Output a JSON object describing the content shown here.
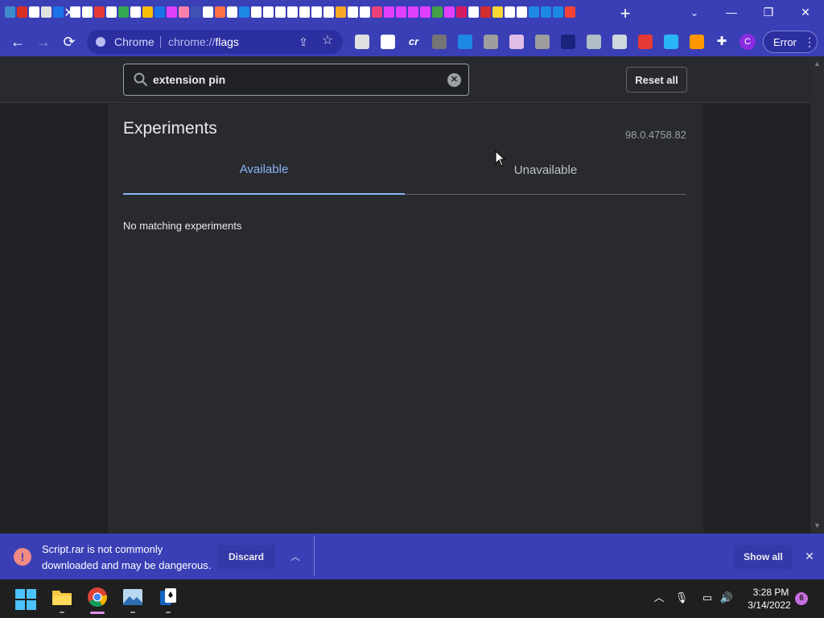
{
  "browser": {
    "tab_icon_colors": [
      "#3f8ccd",
      "#d93025",
      "#ffffff",
      "#e0e0e0",
      "#1a73e8",
      "#ffffff",
      "#ffffff",
      "#e53935",
      "#ffffff",
      "#34a853",
      "#ffffff",
      "#fbbc05",
      "#1a73e8",
      "#e040fb",
      "#ff80ab",
      "#3f51b5",
      "#ffffff",
      "#ff7043",
      "#ffffff",
      "#1e88e5",
      "#ffffff",
      "#ffffff",
      "#ffffff",
      "#ffffff",
      "#ffffff",
      "#ffffff",
      "#ffffff",
      "#f9a825",
      "#ffffff",
      "#ffffff",
      "#ec407a",
      "#e040fb",
      "#e040fb",
      "#e040fb",
      "#e040fb",
      "#43a047",
      "#e040fb",
      "#d81b60",
      "#ffffff",
      "#d32f2f",
      "#fdd835",
      "#ffffff",
      "#ffffff",
      "#1e88e5",
      "#1e88e5",
      "#1e88e5",
      "#f44336"
    ],
    "tab_close": "✕",
    "new_tab": "+",
    "tab_search": "⌄",
    "window": {
      "minimize": "—",
      "maximize": "❐",
      "close": "✕"
    }
  },
  "toolbar": {
    "back": "←",
    "forward": "→",
    "reload": "⟳",
    "omnibox": {
      "label": "Chrome",
      "url_scheme": "chrome://",
      "url_host": "flags",
      "share": "⇪",
      "star": "☆"
    },
    "extensions": [
      {
        "name": "bookmark-ext",
        "color": "#e0e0e0"
      },
      {
        "name": "cross-ext",
        "color": "#ffffff"
      },
      {
        "name": "cr-ext",
        "color": "#ffffff",
        "text": "cr"
      },
      {
        "name": "s-ext",
        "color": "#757575"
      },
      {
        "name": "edge-ext",
        "color": "#1e88e5"
      },
      {
        "name": "puzzle-ext",
        "color": "#9e9e9e"
      },
      {
        "name": "globe-ext",
        "color": "#e1bee7"
      },
      {
        "name": "image-ext",
        "color": "#9e9e9e"
      },
      {
        "name": "r-ext",
        "color": "#1a237e"
      },
      {
        "name": "link-ext",
        "color": "#b0bec5"
      },
      {
        "name": "castle-ext",
        "color": "#cfd8dc"
      },
      {
        "name": "card-ext",
        "color": "#e53935"
      },
      {
        "name": "play-ext",
        "color": "#29b6f6"
      },
      {
        "name": "honey-ext",
        "color": "#ff9800"
      }
    ],
    "puzzle": "✚",
    "profile_initial": "C",
    "error_label": "Error",
    "menu": "⋮"
  },
  "flags": {
    "search_value": "extension pin",
    "clear": "✕",
    "reset_label": "Reset all",
    "title": "Experiments",
    "version": "98.0.4758.82",
    "tab_available": "Available",
    "tab_unavailable": "Unavailable",
    "no_match": "No matching experiments"
  },
  "download": {
    "warning_glyph": "!",
    "message": "Script.rar is not commonly downloaded and may be dangerous.",
    "discard_label": "Discard",
    "chevron": "︿",
    "show_all_label": "Show all",
    "close": "✕"
  },
  "taskbar": {
    "apps": [
      "start",
      "file-explorer",
      "chrome",
      "photos",
      "solitaire"
    ],
    "tray_chevron": "︿",
    "mic": "🎙",
    "network": "▭",
    "volume": "🔊",
    "time": "3:28 PM",
    "date": "3/14/2022",
    "notifications": "6"
  }
}
